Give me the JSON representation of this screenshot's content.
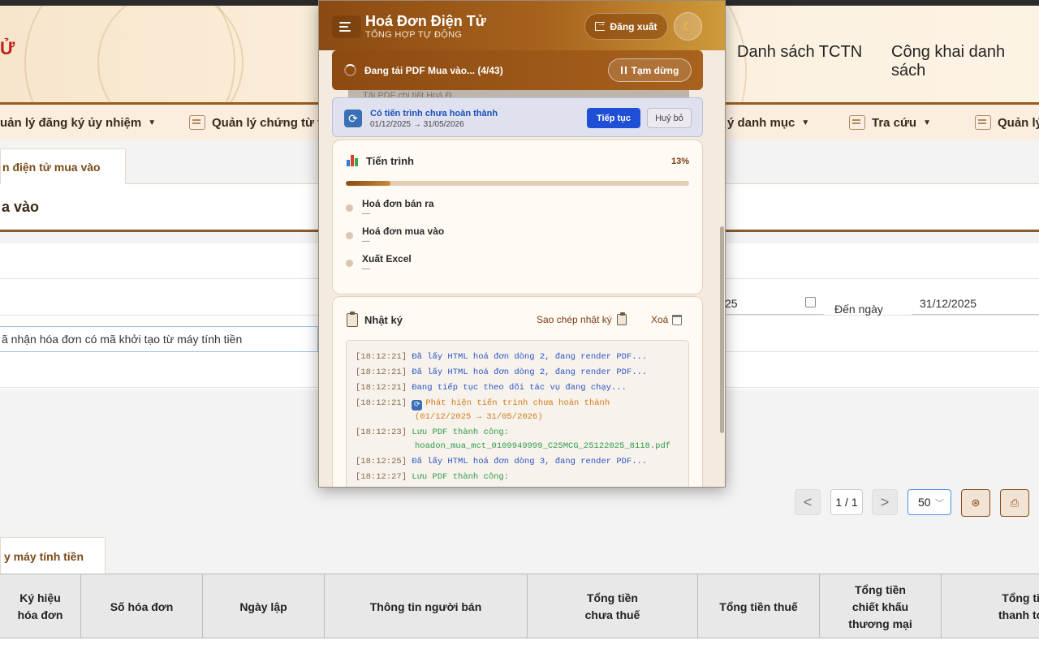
{
  "site": {
    "logo_char": "Ử",
    "top_nav": [
      "Danh sách TCTN",
      "Công khai danh sách"
    ]
  },
  "menu": {
    "items": [
      {
        "label": "uản lý đăng ký ủy nhiệm"
      },
      {
        "label": "Quản lý chứng từ th"
      },
      {
        "label": "ý danh mục"
      },
      {
        "label": "Tra cứu"
      },
      {
        "label": "Quản lý"
      }
    ]
  },
  "page": {
    "tab_label": "n điện tử mua vào",
    "title": "a vào"
  },
  "filters": {
    "search_text": "ã nhận hóa đơn có mã khởi tạo từ máy tính tiền",
    "from_date": "25",
    "to_label": "Đến ngày",
    "to_date": "31/12/2025"
  },
  "pager": {
    "prev": "<",
    "page_indicator": "1 / 1",
    "next": ">",
    "page_size": "50"
  },
  "table": {
    "sub_tab": "y máy tính tiền",
    "headers": [
      "Ký hiệu\nhóa đơn",
      "Số hóa đơn",
      "Ngày lập",
      "Thông tin người bán",
      "Tổng tiền\nchưa thuế",
      "Tổng tiền thuế",
      "Tổng tiền\nchiết khấu\nthương mại",
      "Tổng ti\nthanh to"
    ]
  },
  "popup": {
    "title": "Hoá Đơn Điện Tử",
    "subtitle": "TỔNG HỢP TỰ ĐỘNG",
    "logout_label": "Đăng xuất",
    "theme_icon": "moon-icon",
    "banner": {
      "text": "Đang tải PDF Mua vào... (4/43)",
      "pause_label": "Tạm dừng",
      "ghost_text": "Tải PDF chi tiết Hoá Đ"
    },
    "resume": {
      "title": "Có tiến trình chưa hoàn thành",
      "range": "01/12/2025 → 31/05/2026",
      "continue_label": "Tiếp tục",
      "cancel_label": "Huỷ bỏ"
    },
    "progress": {
      "title": "Tiến trình",
      "percent_label": "13%",
      "percent": 13,
      "steps": [
        {
          "name": "Hoá đơn bán ra",
          "value": "—"
        },
        {
          "name": "Hoá đơn mua vào",
          "value": "—"
        },
        {
          "name": "Xuất Excel",
          "value": "—"
        }
      ]
    },
    "log": {
      "title": "Nhật ký",
      "copy_label": "Sao chép nhật ký",
      "clear_label": "Xoá",
      "entries": [
        {
          "time": "[18:12:21]",
          "msg": "Đã lấy HTML hoá đơn dòng 2, đang render PDF...",
          "color": "#2b54c5"
        },
        {
          "time": "[18:12:21]",
          "msg": "Đã lấy HTML hoá đơn dòng 2, đang render PDF...",
          "color": "#2b54c5"
        },
        {
          "time": "[18:12:21]",
          "msg": "Đang tiếp tục theo dõi tác vụ đang chạy...",
          "color": "#2b54c5"
        },
        {
          "time": "[18:12:21]",
          "msg": "Phát hiện tiến trình chưa hoàn thành",
          "cont": "(01/12/2025 → 31/05/2026)",
          "color": "#d07a1a"
        },
        {
          "time": "[18:12:23]",
          "msg": "Lưu PDF thành công:",
          "cont": "hoadon_mua_mct_0109949999_C25MCG_25122025_8118.pdf",
          "color": "#2f9a4a"
        },
        {
          "time": "[18:12:25]",
          "msg": "Đã lấy HTML hoá đơn dòng 3, đang render PDF...",
          "color": "#2b54c5"
        },
        {
          "time": "[18:12:27]",
          "msg": "Lưu PDF thành công:",
          "color": "#2f9a4a"
        }
      ]
    }
  }
}
